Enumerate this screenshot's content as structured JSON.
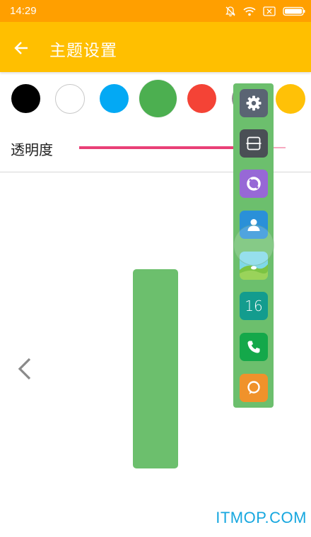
{
  "status_bar": {
    "time": "14:29",
    "icons": [
      "mute-bell-icon",
      "wifi-icon",
      "no-sim-icon",
      "battery-icon"
    ]
  },
  "app_bar": {
    "back_icon": "arrow-left-icon",
    "title": "主题设置",
    "color": "#ffbf00"
  },
  "colors": {
    "swatches": [
      {
        "name": "black",
        "color": "#000000"
      },
      {
        "name": "white",
        "color": "#ffffff"
      },
      {
        "name": "blue",
        "color": "#03a9f4"
      },
      {
        "name": "green",
        "color": "#4caf50",
        "selected": true
      },
      {
        "name": "red",
        "color": "#f44336"
      },
      {
        "name": "grey",
        "color": "#8f8f8f"
      },
      {
        "name": "amber",
        "color": "#ffc107"
      }
    ]
  },
  "opacity": {
    "label": "透明度",
    "value_fraction": 0.78,
    "accent": "#e94077"
  },
  "preview": {
    "prev_icon": "chevron-left-icon",
    "bar_color": "#6cbf6d"
  },
  "dock": {
    "apps": [
      {
        "icon": "settings-icon",
        "color": "#5a6473"
      },
      {
        "icon": "scanner-icon",
        "color": "#4a4f55"
      },
      {
        "icon": "browser-icon",
        "color": "#9768d6"
      },
      {
        "icon": "contacts-icon",
        "color": "#2a90d8"
      },
      {
        "icon": "gallery-icon",
        "color": "#7fd8e8"
      },
      {
        "icon": "calendar-icon",
        "color": "#139c8e",
        "text": "16"
      },
      {
        "icon": "phone-icon",
        "color": "#14a84a"
      },
      {
        "icon": "message-icon",
        "color": "#f0922b"
      }
    ]
  },
  "watermark": "ITMOP.COM"
}
